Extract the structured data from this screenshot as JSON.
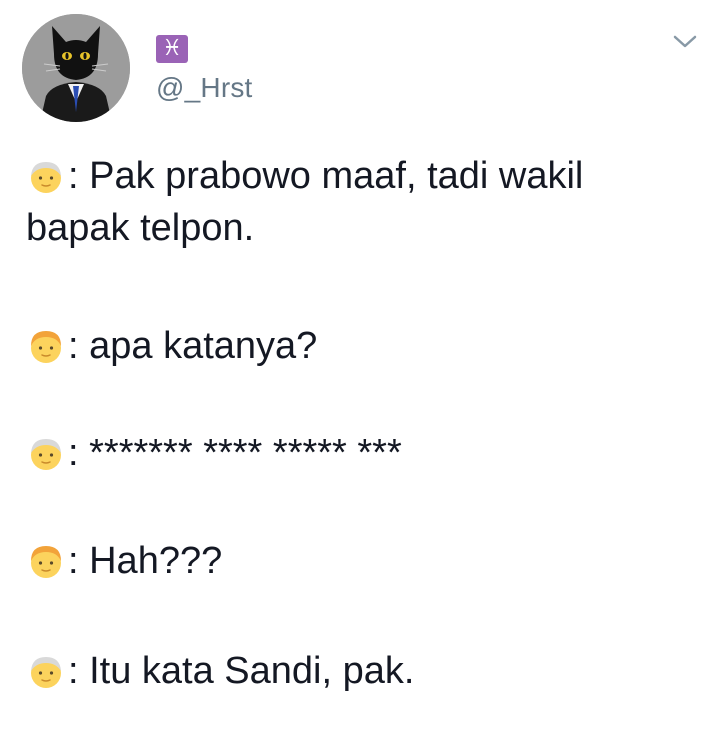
{
  "header": {
    "name_icon": "pisces-icon",
    "name_symbol": "♓",
    "handle": "@_Hrst",
    "avatar_icon": "black-cat-in-suit-avatar",
    "menu_icon": "chevron-down-icon"
  },
  "messages": [
    {
      "speaker_icon": "older-man-emoji",
      "text": ": Pak prabowo maaf, tadi wakil",
      "text2": "bapak telpon."
    },
    {
      "speaker_icon": "blond-man-emoji",
      "text": ": apa katanya?"
    },
    {
      "speaker_icon": "older-man-emoji",
      "text": ": ******* **** ***** ***"
    },
    {
      "speaker_icon": "blond-man-emoji",
      "text": ": Hah???"
    },
    {
      "speaker_icon": "older-man-emoji",
      "text": ": Itu kata Sandi, pak."
    }
  ],
  "colors": {
    "text": "#141823",
    "handle": "#657786",
    "pisces_bg": "#9a63b6",
    "older_man_hair": "#d9d9d9",
    "blond_hair": "#f2a33a",
    "face": "#fcd35d"
  }
}
